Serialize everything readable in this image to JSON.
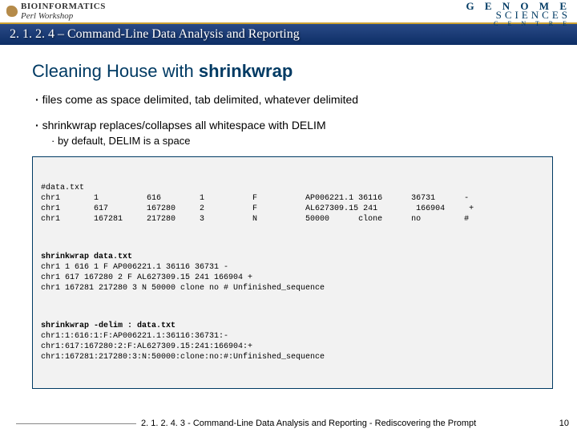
{
  "brand": {
    "left_top": "BIOINFORMATICS",
    "left_bottom": "Perl Workshop",
    "right_line1": "G E N O M E",
    "right_line2": "SCIENCES",
    "right_line3": "C E N T R E"
  },
  "chapter": "2. 1. 2. 4 – Command-Line Data Analysis and Reporting",
  "title_prefix": "Cleaning House with ",
  "title_keyword": "shrinkwrap",
  "bullets": {
    "b1": "files come as space delimited, tab delimited, whatever delimited",
    "b2": "shrinkwrap replaces/collapses all whitespace with DELIM",
    "b2a": "by default, DELIM is a space"
  },
  "code": {
    "block1": "#data.txt\nchr1       1          616        1          F          AP006221.1 36116      36731      -\nchr1       617        167280     2          F          AL627309.15 241        166904     +\nchr1       167281     217280     3          N          50000      clone      no         #",
    "block2": "shrinkwrap data.txt\nchr1 1 616 1 F AP006221.1 36116 36731 -\nchr1 617 167280 2 F AL627309.15 241 166904 +\nchr1 167281 217280 3 N 50000 clone no # Unfinished_sequence",
    "block3": "shrinkwrap -delim : data.txt\nchr1:1:616:1:F:AP006221.1:36116:36731:-\nchr1:617:167280:2:F:AL627309.15:241:166904:+\nchr1:167281:217280:3:N:50000:clone:no:#:Unfinished_sequence"
  },
  "footer": {
    "text": "2. 1. 2. 4. 3 - Command-Line Data Analysis and Reporting - Rediscovering the Prompt",
    "page": "10"
  }
}
